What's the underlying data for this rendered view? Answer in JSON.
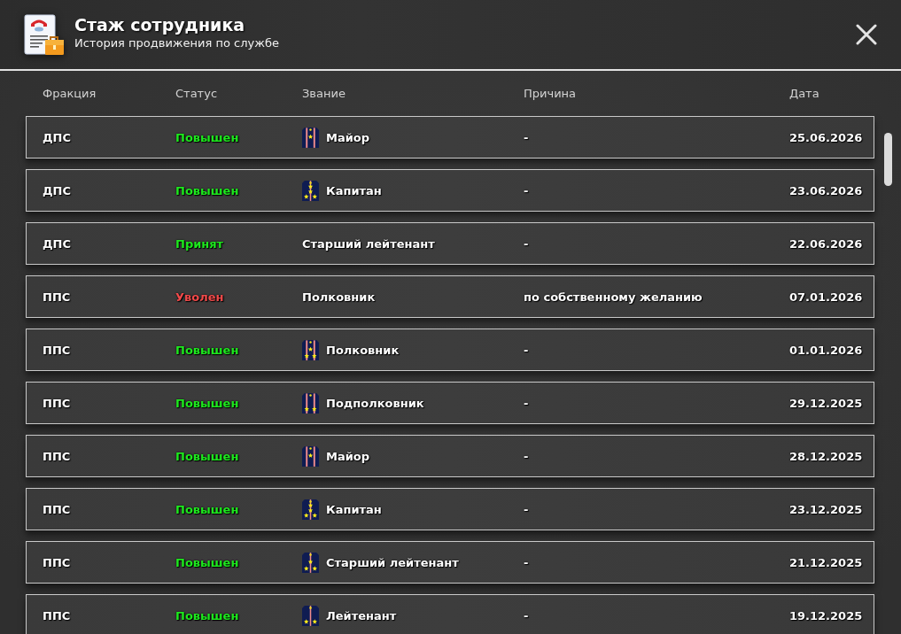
{
  "window": {
    "title": "Стаж сотрудника",
    "subtitle": "История продвижения по службе"
  },
  "table": {
    "columns": [
      "Фракция",
      "Статус",
      "Звание",
      "Причина",
      "Дата"
    ],
    "rows": [
      {
        "faction": "ДПС",
        "status": {
          "text": "Повышен",
          "color": "#1ee81e"
        },
        "rank": "Майор",
        "insignia": {
          "kind": "major"
        },
        "reason": "-",
        "date": "25.06.2026"
      },
      {
        "faction": "ДПС",
        "status": {
          "text": "Повышен",
          "color": "#1ee81e"
        },
        "rank": "Капитан",
        "insignia": {
          "kind": "captain"
        },
        "reason": "-",
        "date": "23.06.2026"
      },
      {
        "faction": "ДПС",
        "status": {
          "text": "Принят",
          "color": "#1ee81e"
        },
        "rank": "Старший лейтенант",
        "reason": "-",
        "date": "22.06.2026"
      },
      {
        "faction": "ППС",
        "status": {
          "text": "Уволен",
          "color": "#f04a4a"
        },
        "rank": "Полковник",
        "reason": "по собственному желанию",
        "date": "07.01.2026"
      },
      {
        "faction": "ППС",
        "status": {
          "text": "Повышен",
          "color": "#1ee81e"
        },
        "rank": "Полковник",
        "insignia": {
          "kind": "colonel"
        },
        "reason": "-",
        "date": "01.01.2026"
      },
      {
        "faction": "ППС",
        "status": {
          "text": "Повышен",
          "color": "#1ee81e"
        },
        "rank": "Подполковник",
        "insignia": {
          "kind": "ltcolonel"
        },
        "reason": "-",
        "date": "29.12.2025"
      },
      {
        "faction": "ППС",
        "status": {
          "text": "Повышен",
          "color": "#1ee81e"
        },
        "rank": "Майор",
        "insignia": {
          "kind": "major"
        },
        "reason": "-",
        "date": "28.12.2025"
      },
      {
        "faction": "ППС",
        "status": {
          "text": "Повышен",
          "color": "#1ee81e"
        },
        "rank": "Капитан",
        "insignia": {
          "kind": "captain"
        },
        "reason": "-",
        "date": "23.12.2025"
      },
      {
        "faction": "ППС",
        "status": {
          "text": "Повышен",
          "color": "#1ee81e"
        },
        "rank": "Старший лейтенант",
        "insignia": {
          "kind": "seniorlieutenant"
        },
        "reason": "-",
        "date": "21.12.2025"
      },
      {
        "faction": "ППС",
        "status": {
          "text": "Повышен",
          "color": "#1ee81e"
        },
        "rank": "Лейтенант",
        "insignia": {
          "kind": "lieutenant"
        },
        "reason": "-",
        "date": "19.12.2025"
      }
    ]
  }
}
